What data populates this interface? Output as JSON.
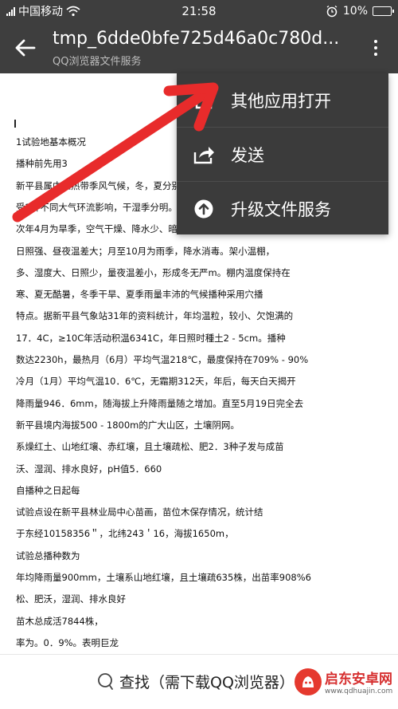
{
  "status_bar": {
    "carrier": "中国移动",
    "time": "21:58",
    "battery_percent": "10%",
    "battery_level": 0.1,
    "icons": [
      "signal-icon",
      "wifi-icon",
      "alarm-icon",
      "battery-icon"
    ]
  },
  "app_bar": {
    "title": "tmp_6dde0bfe725d46a0c780d...",
    "subtitle": "QQ浏览器文件服务"
  },
  "menu": {
    "items": [
      {
        "label": "其他应用打开",
        "icon": "open-external-icon"
      },
      {
        "label": "发送",
        "icon": "share-icon"
      },
      {
        "label": "升级文件服务",
        "icon": "upgrade-icon"
      }
    ]
  },
  "document": {
    "lines": [
      "1试验地基本概况",
      "播种前先用3",
      "新平县属中亚热带季风气候，冬，夏分别",
      "受2种不同大气环流影响，干湿季分明。1",
      "次年4月为旱季，空气干燥、降水少、暗天",
      "日照强、昼夜温差大；月至10月为雨季，降水消毒。架小温棚，",
      "多、湿度大、日照少，量夜温差小，形成冬无严m。棚内温度保持在",
      "寒、夏无酷暑，冬季干旱、夏季雨量丰沛的气候播种采用穴播",
      "特点。据新平县气象站31年的资料统计，年均温粒，较小、欠饱满的",
      "17．4C，≥10C年活动积温6341C，年日照时種土2 - 5cm。播种",
      "数达2230h，最热月（6月）平均气温218℃，最度保持在709% - 90%",
      "冷月（1月）平均气温10．6℃，无霜期312天，年后，每天白天揭开",
      "降雨量946．6mm，随海拔上升降雨量随之增加。直至5月19日完全去",
      "新平县境内海拔500 - 1800m的广大山区，土壤阴网。",
      "系燥红土、山地红壤、赤红壤，且土壤疏松、肥2．3种子发与成苗",
      "沃、湿润、排水良好，pH值5．660",
      "自播种之日起每",
      "试验点设在新平县林业局中心苗画，苗位木保存情况，统计结",
      "于东经10158356＂，北纬243＇16，海拔1650m，",
      "试验总播种数为",
      "年均降雨量900mm，土壤系山地红壤，且土壤疏635株，出苗率908%6",
      "松、肥沃，湿润、排水良好",
      "苗木总成活7844株，",
      "率为。0．9%。表明巨龙"
    ]
  },
  "bottom_bar": {
    "find_label": "查找（需下载QQ浏览器）",
    "watermark_name": "启东安卓网",
    "watermark_url": "www.qdhuajin.com"
  },
  "colors": {
    "bar_bg": "#3e3e3e",
    "menu_bg": "#3b3b3b",
    "arrow_red": "#e82b2b"
  }
}
